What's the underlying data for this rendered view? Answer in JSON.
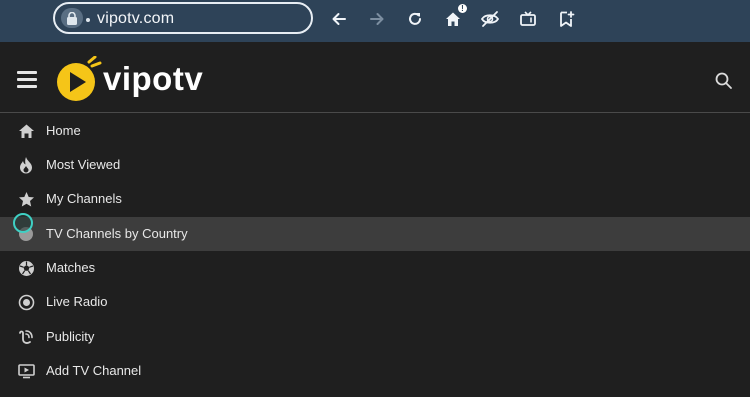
{
  "browser": {
    "url": "vipotv.com",
    "home_badge": "!"
  },
  "app": {
    "logo_text": "vipotv",
    "brand_color": "#f5c518"
  },
  "nav": {
    "items": [
      {
        "label": "Home",
        "icon": "home-icon"
      },
      {
        "label": "Most Viewed",
        "icon": "flame-icon"
      },
      {
        "label": "My Channels",
        "icon": "star-icon"
      },
      {
        "label": "TV Channels by Country",
        "icon": "globe-icon",
        "active": true
      },
      {
        "label": "Matches",
        "icon": "soccer-ball-icon"
      },
      {
        "label": "Live Radio",
        "icon": "radio-icon"
      },
      {
        "label": "Publicity",
        "icon": "megaphone-icon"
      },
      {
        "label": "Add TV Channel",
        "icon": "add-tv-icon"
      }
    ]
  }
}
